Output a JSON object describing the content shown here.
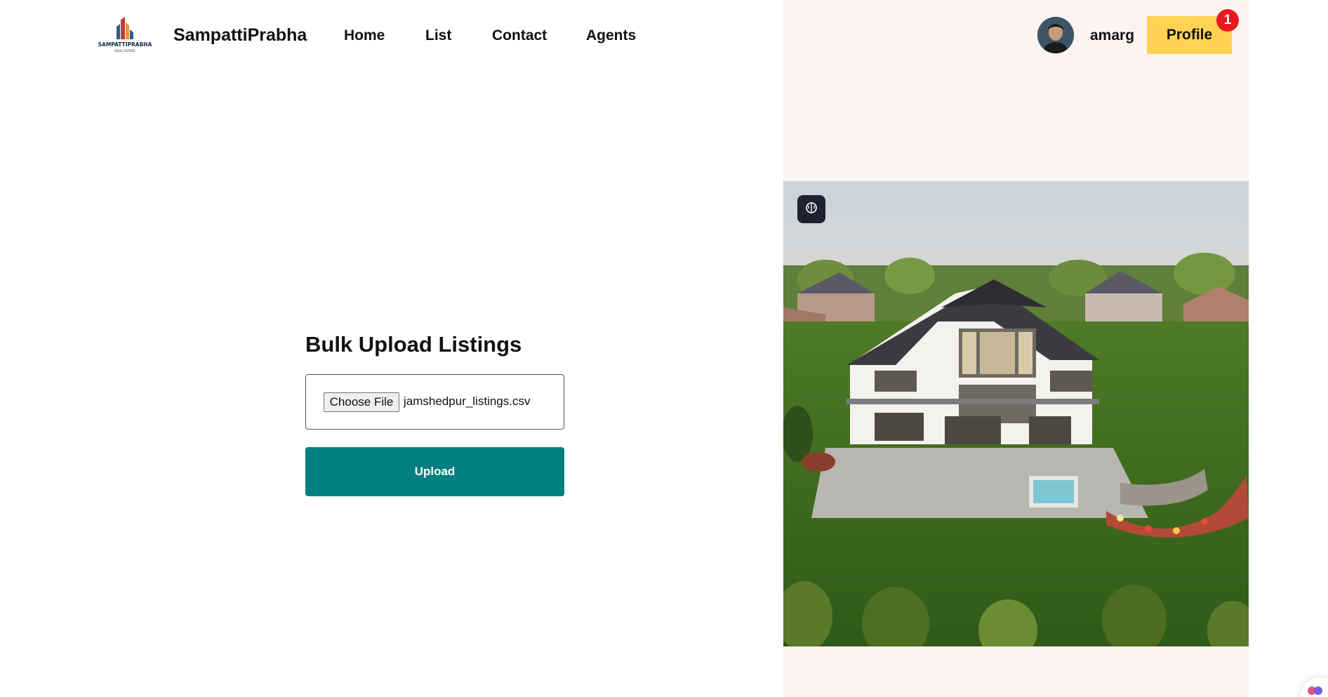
{
  "brand": {
    "name": "SampattiPrabha",
    "logo_text": "SAMPATTIPRABHA",
    "logo_subtext": "REAL ESTATE"
  },
  "nav": {
    "items": [
      {
        "label": "Home"
      },
      {
        "label": "List"
      },
      {
        "label": "Contact"
      },
      {
        "label": "Agents"
      }
    ]
  },
  "user": {
    "username": "amarg",
    "profile_label": "Profile",
    "notification_count": "1"
  },
  "upload_form": {
    "title": "Bulk Upload Listings",
    "choose_file_label": "Choose File",
    "selected_file": "jamshedpur_listings.csv",
    "upload_label": "Upload"
  },
  "colors": {
    "accent": "#008080",
    "profile_button": "#ffd253",
    "badge": "#e8191e",
    "side_panel": "#fcf4f2"
  },
  "icons": {
    "ai_button": "brain-icon",
    "corner_widget": "chat-widget-icon"
  }
}
